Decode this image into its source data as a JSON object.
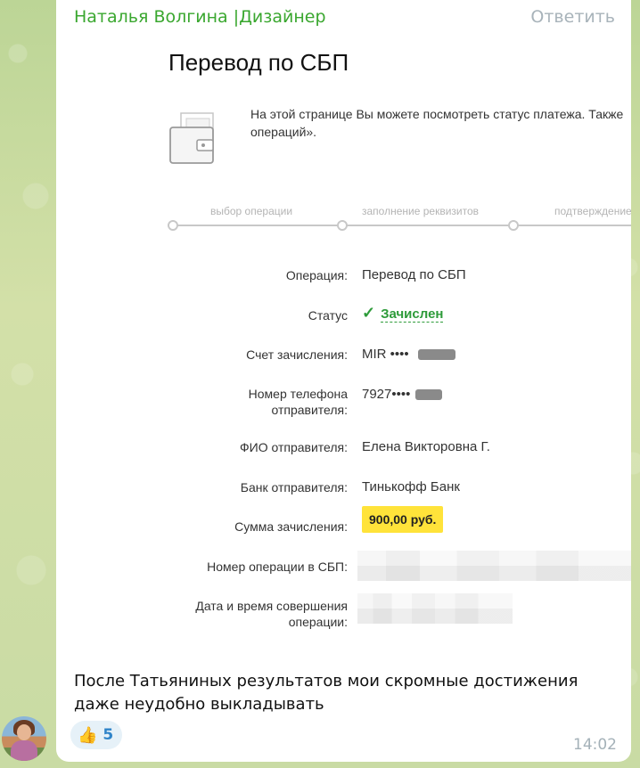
{
  "message": {
    "sender": "Наталья Волгина |Дизайнер",
    "reply_label": "Ответить",
    "caption": "После Татьяниных результатов мои скромные достижения даже неудобно выкладывать",
    "reaction_emoji": "👍",
    "reaction_count": "5",
    "time": "14:02"
  },
  "screenshot": {
    "title": "Перевод по СБП",
    "intro_line1": "На этой странице Вы можете посмотреть статус платежа. Также",
    "intro_line2": "операций».",
    "steps": [
      "выбор операции",
      "заполнение реквизитов",
      "подтверждение"
    ],
    "fields": {
      "operation_label": "Операция:",
      "operation_value": "Перевод по СБП",
      "status_label": "Статус",
      "status_value": "Зачислен",
      "account_label": "Счет зачисления:",
      "account_value": "MIR ••••",
      "phone_label_1": "Номер телефона",
      "phone_label_2": "отправителя:",
      "phone_value": "7927••••",
      "fio_label": "ФИО отправителя:",
      "fio_value": "Елена Викторовна Г.",
      "bank_label": "Банк отправителя:",
      "bank_value": "Тинькофф Банк",
      "amount_label": "Сумма зачисления:",
      "amount_value": "900,00 руб.",
      "sbp_number_label": "Номер операции в СБП:",
      "datetime_label_1": "Дата и время совершения",
      "datetime_label_2": "операции:"
    }
  },
  "colors": {
    "sender": "#3aa72f",
    "status_ok": "#2e9b3a",
    "amount_highlight": "#ffe33a",
    "reaction_count": "#2f84c9"
  }
}
